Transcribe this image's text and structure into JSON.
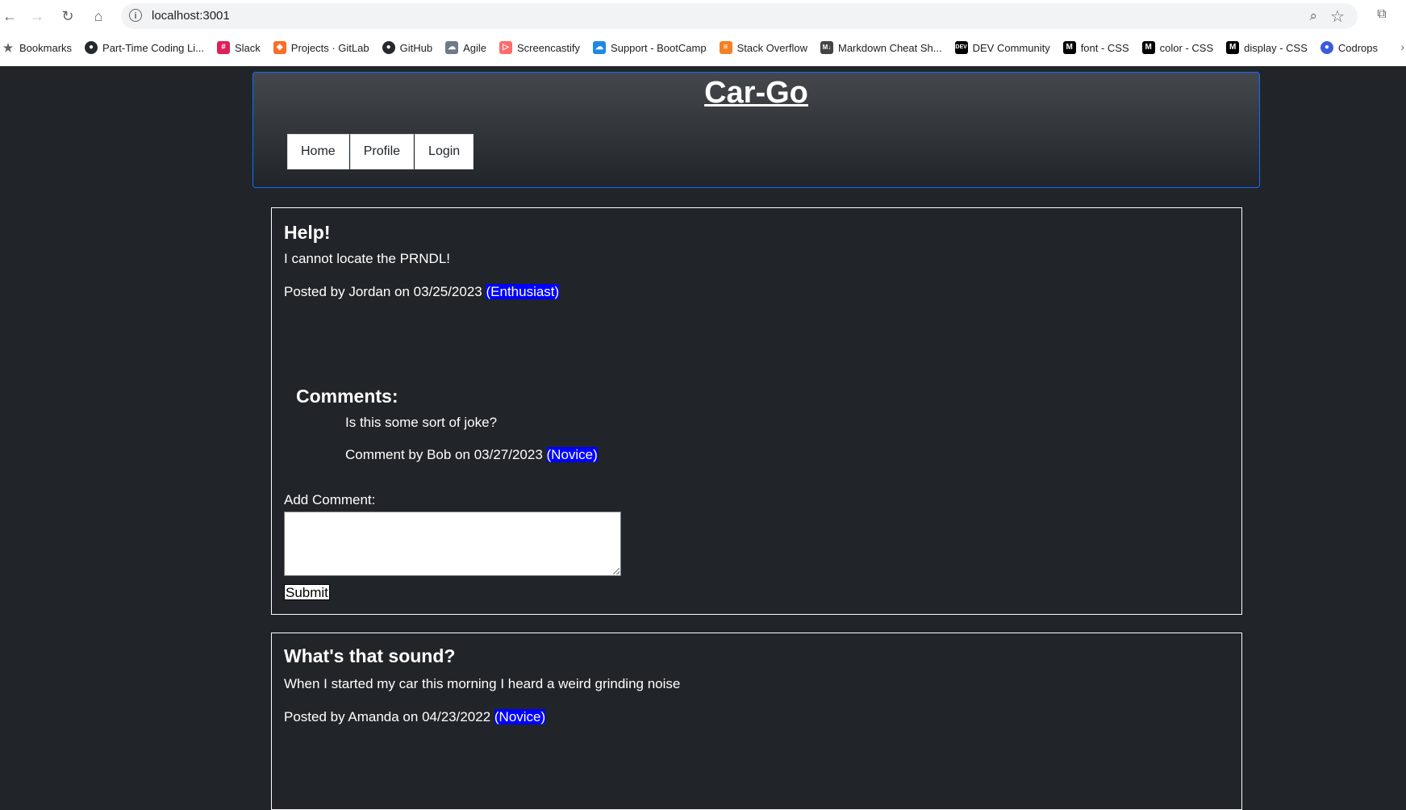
{
  "browser": {
    "url": "localhost:3001",
    "bookmarks": [
      {
        "label": "Bookmarks",
        "icon": "star-icon"
      },
      {
        "label": "Part-Time Coding Li...",
        "icon": "github-icon"
      },
      {
        "label": "Slack",
        "icon": "slack-icon"
      },
      {
        "label": "Projects · GitLab",
        "icon": "gitlab-icon"
      },
      {
        "label": "GitHub",
        "icon": "github-icon"
      },
      {
        "label": "Agile",
        "icon": "agile-icon"
      },
      {
        "label": "Screencastify",
        "icon": "screencastify-icon"
      },
      {
        "label": "Support - BootCamp",
        "icon": "cloud-icon"
      },
      {
        "label": "Stack Overflow",
        "icon": "stackoverflow-icon"
      },
      {
        "label": "Markdown Cheat Sh...",
        "icon": "markdown-icon"
      },
      {
        "label": "DEV Community",
        "icon": "dev-icon"
      },
      {
        "label": "font - CSS",
        "icon": "mdn-icon"
      },
      {
        "label": "color - CSS",
        "icon": "mdn-icon"
      },
      {
        "label": "display - CSS",
        "icon": "mdn-icon"
      },
      {
        "label": "Codrops",
        "icon": "codrops-icon"
      }
    ]
  },
  "site": {
    "title": "Car-Go",
    "nav": {
      "home": "Home",
      "profile": "Profile",
      "login": "Login"
    }
  },
  "posts": [
    {
      "title": "Help!",
      "body": "I cannot locate the PRNDL!",
      "meta": "Posted by Jordan on 03/25/2023",
      "badge": "(Enthusiast)",
      "comments_heading": "Comments:",
      "comments": [
        {
          "text": "Is this some sort of joke?",
          "meta": "Comment by Bob on 03/27/2023",
          "badge": "(Novice)"
        }
      ],
      "add_comment_label": "Add Comment:",
      "comment_value": "",
      "submit_label": "Submit"
    },
    {
      "title": "What's that sound?",
      "body": "When I started my car this morning I heard a weird grinding noise",
      "meta": "Posted by Amanda on 04/23/2022",
      "badge": "(Novice)"
    }
  ],
  "colors": {
    "background": "#212529",
    "header_border": "#0d6efd",
    "badge": "#0000ff"
  }
}
